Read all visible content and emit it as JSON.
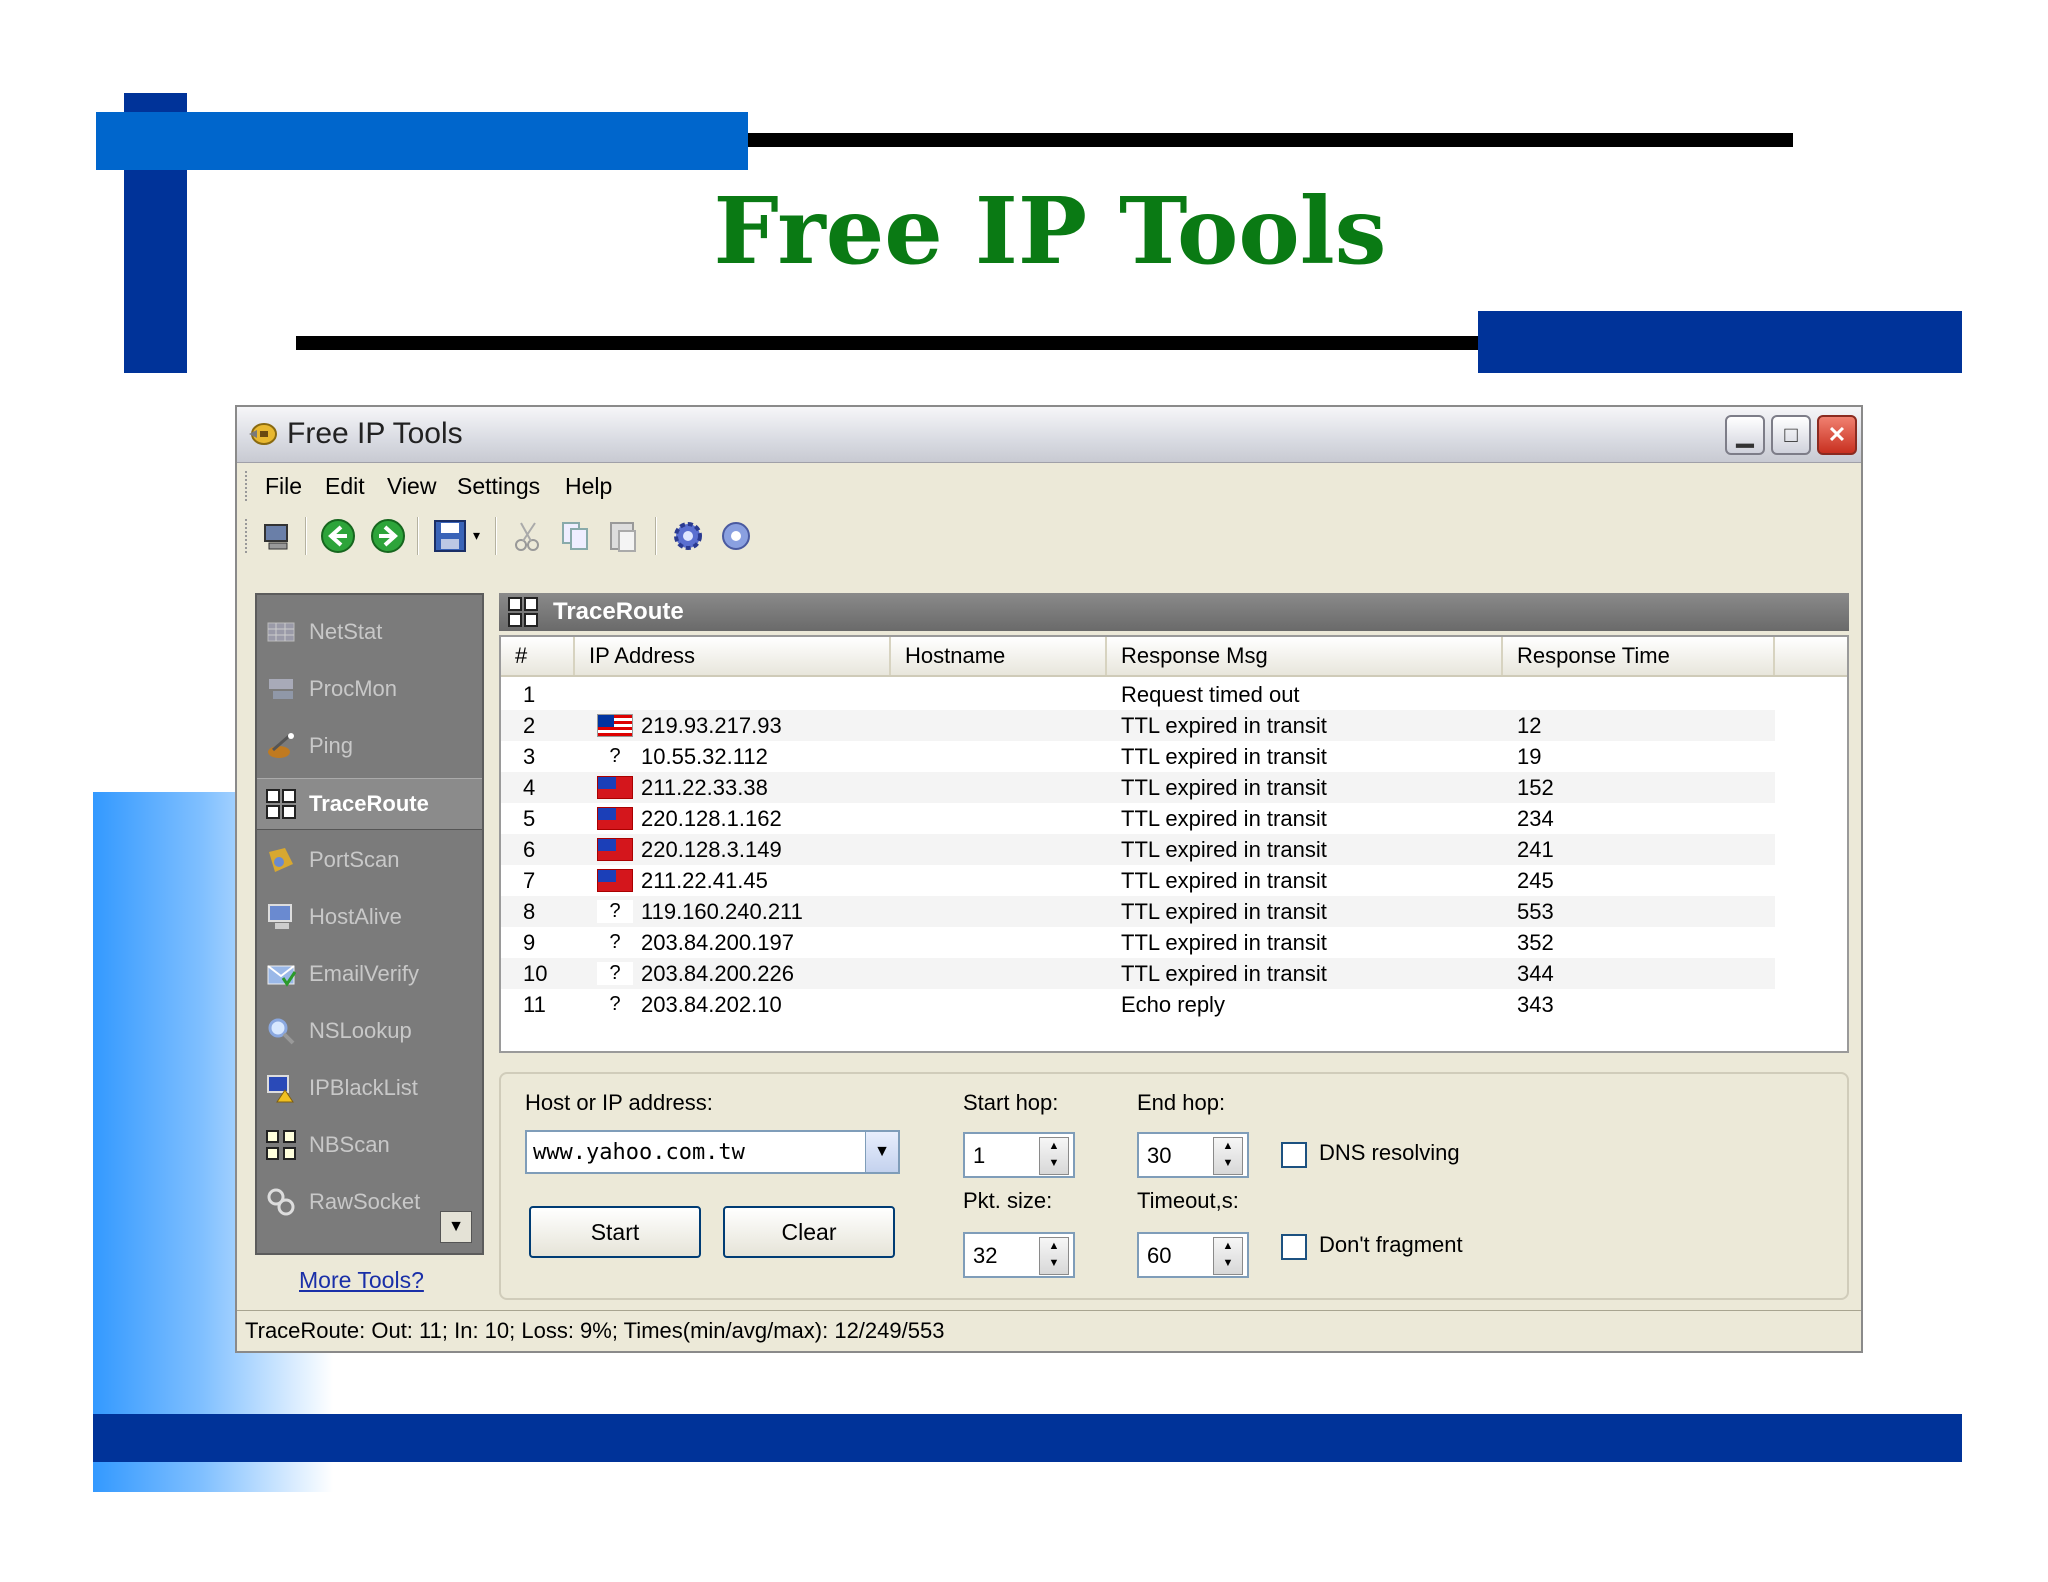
{
  "slide": {
    "title": "Free IP Tools"
  },
  "window": {
    "title": "Free IP Tools",
    "controls": {
      "minimize": "▁",
      "maximize": "□",
      "close": "✕"
    }
  },
  "menu": [
    "File",
    "Edit",
    "View",
    "Settings",
    "Help"
  ],
  "toolbar_icons": [
    "computer-icon",
    "back-icon",
    "forward-icon",
    "save-icon",
    "cut-icon",
    "copy-icon",
    "paste-icon",
    "settings-icon",
    "help-icon"
  ],
  "sidebar": {
    "items": [
      {
        "label": "NetStat",
        "icon": "netstat-icon"
      },
      {
        "label": "ProcMon",
        "icon": "procmon-icon"
      },
      {
        "label": "Ping",
        "icon": "ping-icon"
      },
      {
        "label": "TraceRoute",
        "icon": "traceroute-icon",
        "active": true
      },
      {
        "label": "PortScan",
        "icon": "portscan-icon"
      },
      {
        "label": "HostAlive",
        "icon": "hostalive-icon"
      },
      {
        "label": "EmailVerify",
        "icon": "emailverify-icon"
      },
      {
        "label": "NSLookup",
        "icon": "nslookup-icon"
      },
      {
        "label": "IPBlackList",
        "icon": "ipblacklist-icon"
      },
      {
        "label": "NBScan",
        "icon": "nbscan-icon"
      },
      {
        "label": "RawSocket",
        "icon": "rawsocket-icon"
      }
    ],
    "more_tools": "More Tools?"
  },
  "panel": {
    "title": "TraceRoute"
  },
  "table": {
    "columns": [
      "#",
      "IP Address",
      "Hostname",
      "Response Msg",
      "Response Time"
    ],
    "rows": [
      {
        "n": "1",
        "flag": "",
        "ip": "",
        "host": "",
        "msg": "Request timed out",
        "time": ""
      },
      {
        "n": "2",
        "flag": "my",
        "ip": "219.93.217.93",
        "host": "",
        "msg": "TTL expired in transit",
        "time": "12"
      },
      {
        "n": "3",
        "flag": "unk",
        "ip": "10.55.32.112",
        "host": "",
        "msg": "TTL expired in transit",
        "time": "19"
      },
      {
        "n": "4",
        "flag": "tw",
        "ip": "211.22.33.38",
        "host": "",
        "msg": "TTL expired in transit",
        "time": "152"
      },
      {
        "n": "5",
        "flag": "tw",
        "ip": "220.128.1.162",
        "host": "",
        "msg": "TTL expired in transit",
        "time": "234"
      },
      {
        "n": "6",
        "flag": "tw",
        "ip": "220.128.3.149",
        "host": "",
        "msg": "TTL expired in transit",
        "time": "241"
      },
      {
        "n": "7",
        "flag": "tw",
        "ip": "211.22.41.45",
        "host": "",
        "msg": "TTL expired in transit",
        "time": "245"
      },
      {
        "n": "8",
        "flag": "unk",
        "ip": "119.160.240.211",
        "host": "",
        "msg": "TTL expired in transit",
        "time": "553"
      },
      {
        "n": "9",
        "flag": "unk",
        "ip": "203.84.200.197",
        "host": "",
        "msg": "TTL expired in transit",
        "time": "352"
      },
      {
        "n": "10",
        "flag": "unk",
        "ip": "203.84.200.226",
        "host": "",
        "msg": "TTL expired in transit",
        "time": "344"
      },
      {
        "n": "11",
        "flag": "unk",
        "ip": "203.84.202.10",
        "host": "",
        "msg": "Echo reply",
        "time": "343"
      }
    ]
  },
  "form": {
    "host_label": "Host or IP address:",
    "host_value": "www.yahoo.com.tw",
    "start_hop_label": "Start hop:",
    "start_hop_value": "1",
    "end_hop_label": "End hop:",
    "end_hop_value": "30",
    "pkt_size_label": "Pkt. size:",
    "pkt_size_value": "32",
    "timeout_label": "Timeout,s:",
    "timeout_value": "60",
    "dns_label": "DNS resolving",
    "dont_fragment_label": "Don't fragment",
    "start_label": "Start",
    "clear_label": "Clear",
    "unknown_flag": "?"
  },
  "status": "TraceRoute: Out: 11; In: 10; Loss: 9%; Times(min/avg/max): 12/249/553"
}
